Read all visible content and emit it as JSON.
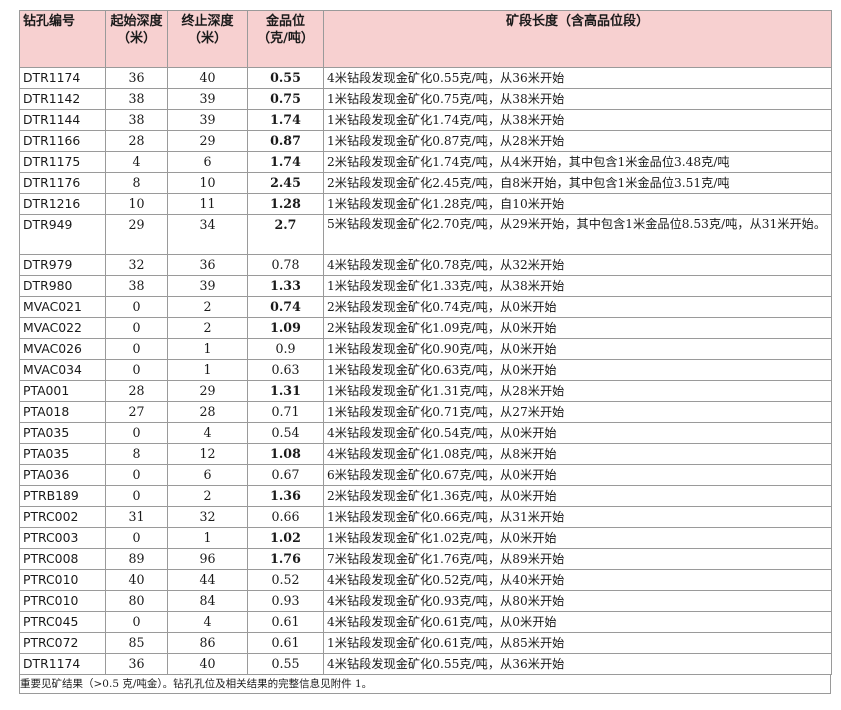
{
  "headers": {
    "hole_id": "钻孔编号",
    "from": "起始深度（米）",
    "to": "终止深度（米）",
    "grade": "金品位（克/吨）",
    "description": "矿段长度（含高品位段）"
  },
  "rows": [
    {
      "id": "DTR1174",
      "from": "36",
      "to": "40",
      "grade": "0.55",
      "bold": true,
      "desc": "4米钻段发现金矿化0.55克/吨，从36米开始"
    },
    {
      "id": "DTR1142",
      "from": "38",
      "to": "39",
      "grade": "0.75",
      "bold": true,
      "desc": "1米钻段发现金矿化0.75克/吨，从38米开始"
    },
    {
      "id": "DTR1144",
      "from": "38",
      "to": "39",
      "grade": "1.74",
      "bold": true,
      "desc": "1米钻段发现金矿化1.74克/吨，从38米开始"
    },
    {
      "id": "DTR1166",
      "from": "28",
      "to": "29",
      "grade": "0.87",
      "bold": true,
      "desc": "1米钻段发现金矿化0.87克/吨，从28米开始"
    },
    {
      "id": "DTR1175",
      "from": "4",
      "to": "6",
      "grade": "1.74",
      "bold": true,
      "desc": "2米钻段发现金矿化1.74克/吨，从4米开始，其中包含1米金品位3.48克/吨"
    },
    {
      "id": "DTR1176",
      "from": "8",
      "to": "10",
      "grade": "2.45",
      "bold": true,
      "desc": "2米钻段发现金矿化2.45克/吨，自8米开始，其中包含1米金品位3.51克/吨"
    },
    {
      "id": "DTR1216",
      "from": "10",
      "to": "11",
      "grade": "1.28",
      "bold": true,
      "desc": "1米钻段发现金矿化1.28克/吨，自10米开始"
    },
    {
      "id": "DTR949",
      "from": "29",
      "to": "34",
      "grade": "2.7",
      "bold": true,
      "tall": true,
      "desc": "5米钻段发现金矿化2.70克/吨，从29米开始，其中包含1米金品位8.53克/吨，从31米开始。"
    },
    {
      "id": "DTR979",
      "from": "32",
      "to": "36",
      "grade": "0.78",
      "bold": false,
      "desc": "4米钻段发现金矿化0.78克/吨，从32米开始"
    },
    {
      "id": "DTR980",
      "from": "38",
      "to": "39",
      "grade": "1.33",
      "bold": true,
      "desc": "1米钻段发现金矿化1.33克/吨，从38米开始"
    },
    {
      "id": "MVAC021",
      "from": "0",
      "to": "2",
      "grade": "0.74",
      "bold": true,
      "desc": "2米钻段发现金矿化0.74克/吨，从0米开始"
    },
    {
      "id": "MVAC022",
      "from": "0",
      "to": "2",
      "grade": "1.09",
      "bold": true,
      "desc": "2米钻段发现金矿化1.09克/吨，从0米开始"
    },
    {
      "id": "MVAC026",
      "from": "0",
      "to": "1",
      "grade": "0.9",
      "bold": false,
      "desc": "1米钻段发现金矿化0.90克/吨，从0米开始"
    },
    {
      "id": "MVAC034",
      "from": "0",
      "to": "1",
      "grade": "0.63",
      "bold": false,
      "desc": "1米钻段发现金矿化0.63克/吨，从0米开始"
    },
    {
      "id": "PTA001",
      "from": "28",
      "to": "29",
      "grade": "1.31",
      "bold": true,
      "desc": "1米钻段发现金矿化1.31克/吨，从28米开始"
    },
    {
      "id": "PTA018",
      "from": "27",
      "to": "28",
      "grade": "0.71",
      "bold": false,
      "desc": "1米钻段发现金矿化0.71克/吨，从27米开始"
    },
    {
      "id": "PTA035",
      "from": "0",
      "to": "4",
      "grade": "0.54",
      "bold": false,
      "desc": "4米钻段发现金矿化0.54克/吨，从0米开始"
    },
    {
      "id": "PTA035",
      "from": "8",
      "to": "12",
      "grade": "1.08",
      "bold": true,
      "desc": "4米钻段发现金矿化1.08克/吨，从8米开始"
    },
    {
      "id": "PTA036",
      "from": "0",
      "to": "6",
      "grade": "0.67",
      "bold": false,
      "desc": "6米钻段发现金矿化0.67克/吨，从0米开始"
    },
    {
      "id": "PTRB189",
      "from": "0",
      "to": "2",
      "grade": "1.36",
      "bold": true,
      "desc": "2米钻段发现金矿化1.36克/吨，从0米开始"
    },
    {
      "id": "PTRC002",
      "from": "31",
      "to": "32",
      "grade": "0.66",
      "bold": false,
      "desc": "1米钻段发现金矿化0.66克/吨，从31米开始"
    },
    {
      "id": "PTRC003",
      "from": "0",
      "to": "1",
      "grade": "1.02",
      "bold": true,
      "desc": "1米钻段发现金矿化1.02克/吨，从0米开始"
    },
    {
      "id": "PTRC008",
      "from": "89",
      "to": "96",
      "grade": "1.76",
      "bold": true,
      "desc": "7米钻段发现金矿化1.76克/吨，从89米开始"
    },
    {
      "id": "PTRC010",
      "from": "40",
      "to": "44",
      "grade": "0.52",
      "bold": false,
      "desc": "4米钻段发现金矿化0.52克/吨，从40米开始"
    },
    {
      "id": "PTRC010",
      "from": "80",
      "to": "84",
      "grade": "0.93",
      "bold": false,
      "desc": "4米钻段发现金矿化0.93克/吨，从80米开始"
    },
    {
      "id": "PTRC045",
      "from": "0",
      "to": "4",
      "grade": "0.61",
      "bold": false,
      "desc": "4米钻段发现金矿化0.61克/吨，从0米开始"
    },
    {
      "id": "PTRC072",
      "from": "85",
      "to": "86",
      "grade": "0.61",
      "bold": false,
      "desc": "1米钻段发现金矿化0.61克/吨，从85米开始"
    },
    {
      "id": "DTR1174",
      "from": "36",
      "to": "40",
      "grade": "0.55",
      "bold": false,
      "desc": "4米钻段发现金矿化0.55克/吨，从36米开始"
    }
  ],
  "footnote": "重要见矿结果（>0.5 克/吨金）。钻孔孔位及相关结果的完整信息见附件 1。"
}
